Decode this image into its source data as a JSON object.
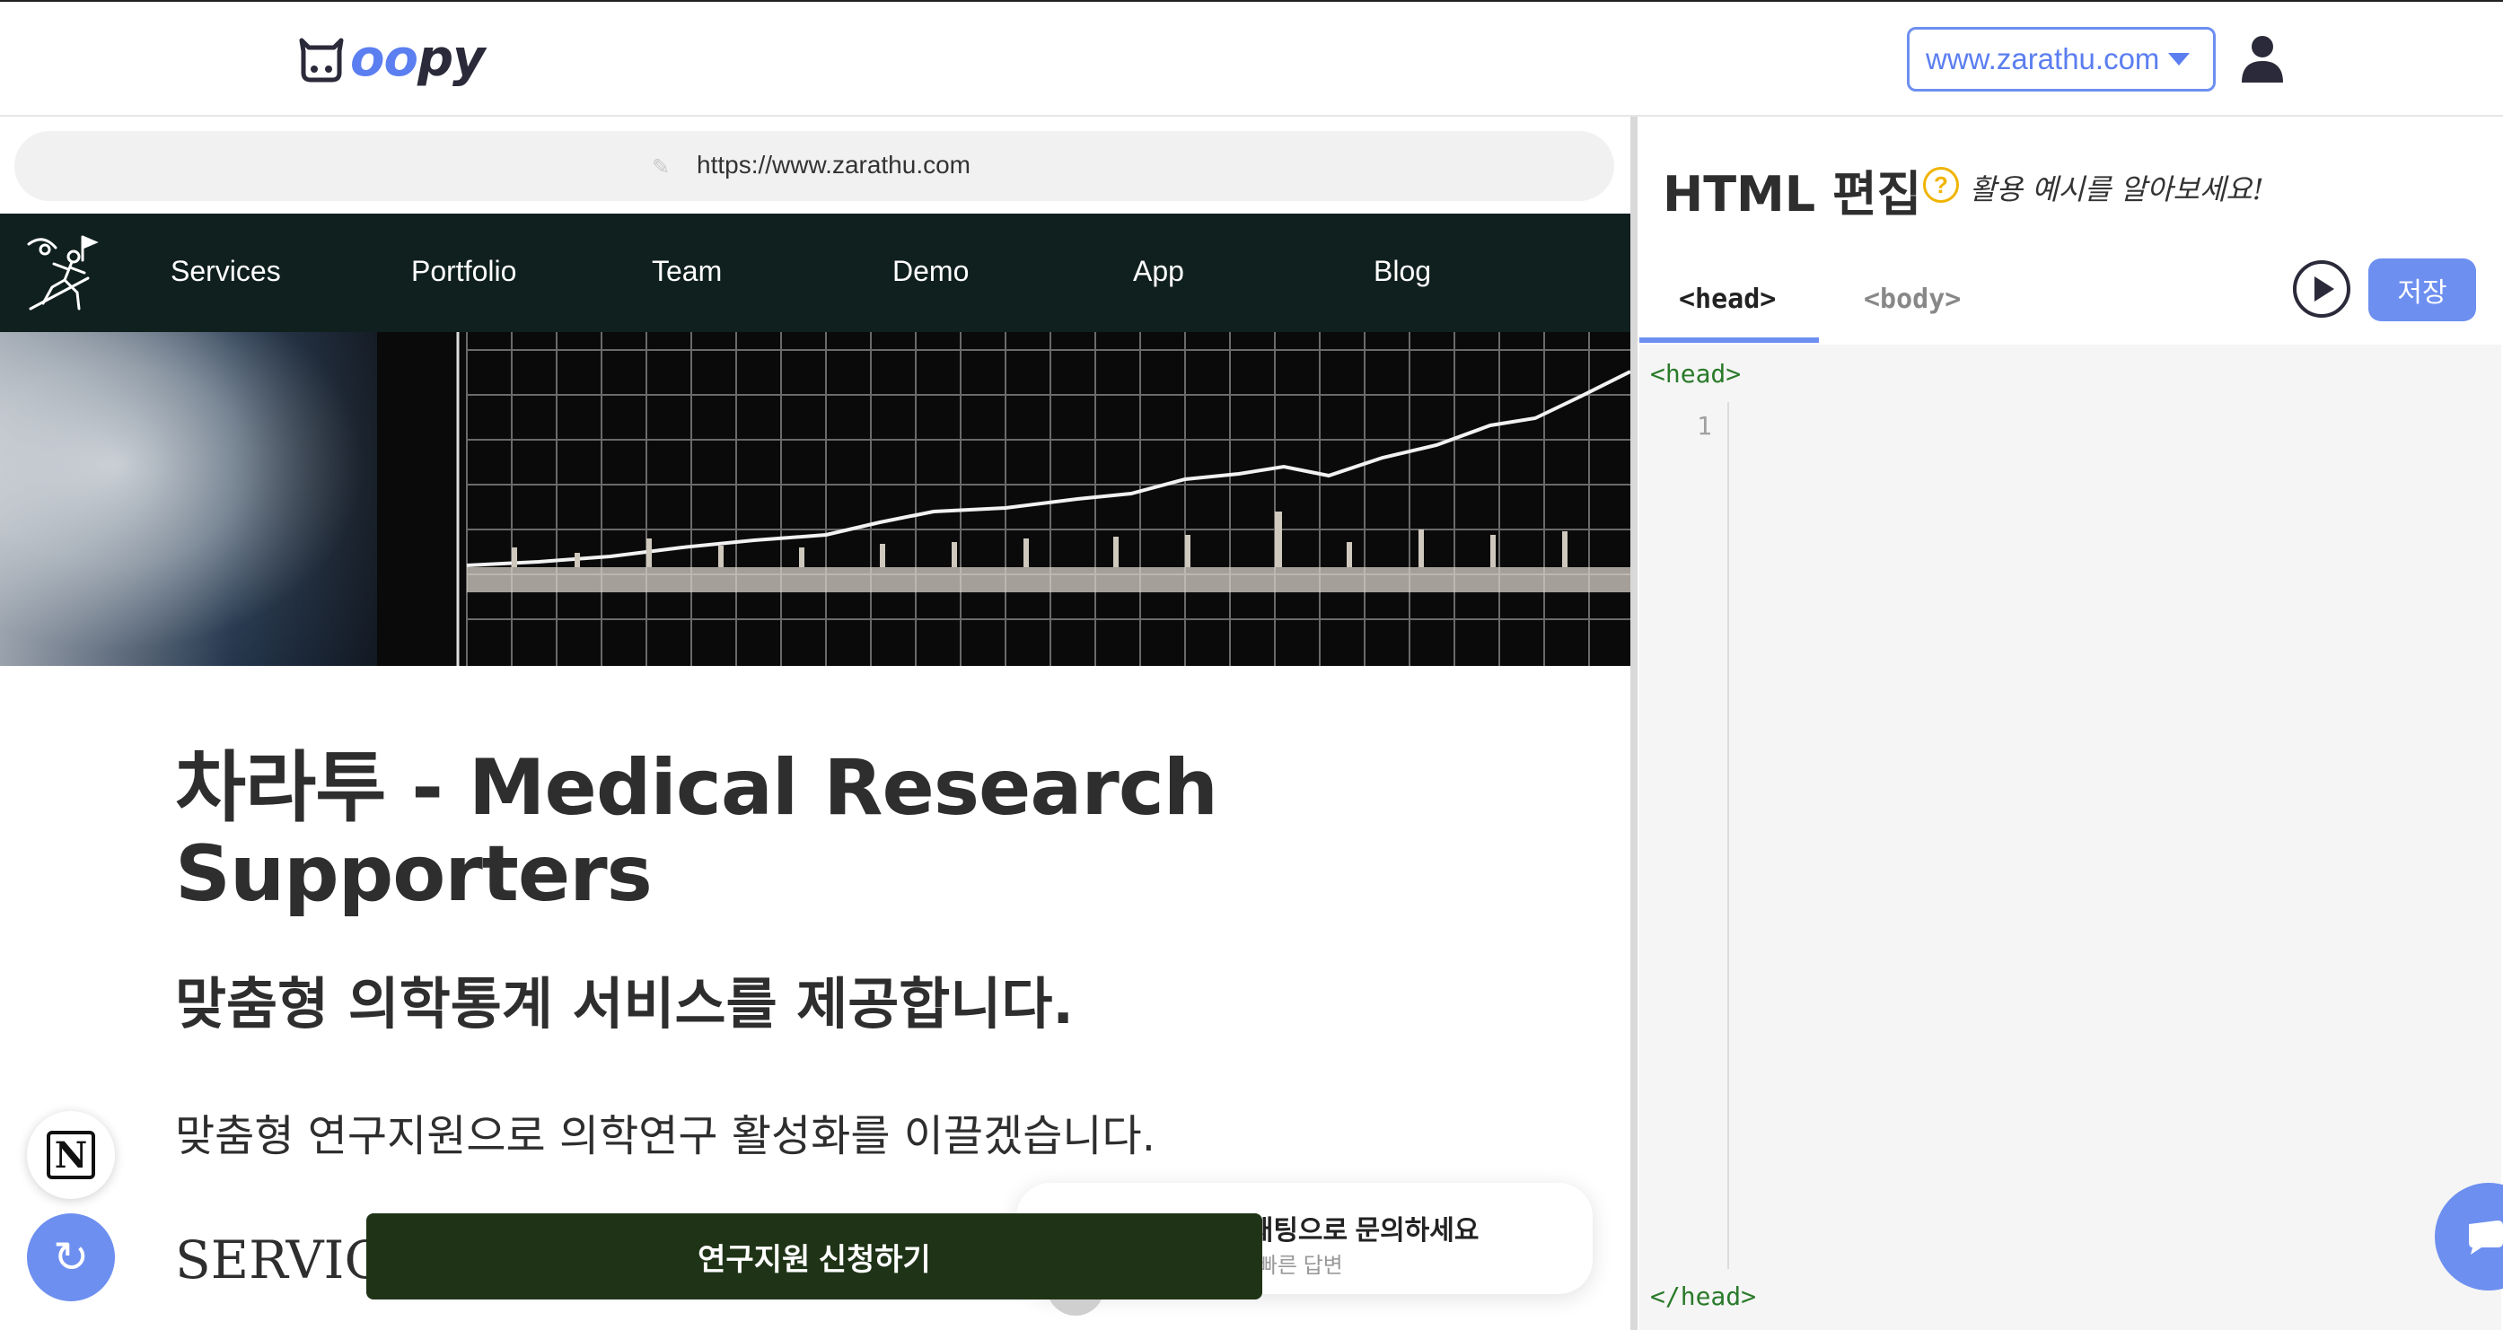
{
  "app": {
    "logo_text_blue": "oo",
    "logo_text_dark": "py",
    "domain": "www.zarathu.com"
  },
  "preview": {
    "url": "https://www.zarathu.com",
    "nav": [
      "Services",
      "Portfolio",
      "Team",
      "Demo",
      "App",
      "Blog"
    ],
    "heading": "차라투 - Medical Research Supporters",
    "subheading": "맞춤형 의학통계 서비스를 제공합니다.",
    "tagline": "맞춤형 연구지원으로 의학연구 활성화를 이끌겠습니다.",
    "section_title": "SERVICES",
    "chat_card_title": "궁금하면 채팅으로 문의하세요",
    "chat_card_sub": "내 빠른 답변",
    "apply_button": "연구지원 신청하기"
  },
  "editor": {
    "title": "HTML 편집",
    "help_text": "활용 예시를 알아보세요!",
    "tabs": [
      "<head>",
      "<body>"
    ],
    "active_tab": "<head>",
    "save_label": "저장",
    "code_open": "<head>",
    "code_close": "</head>",
    "line_number": "1"
  },
  "colors": {
    "accent": "#6d8ff0",
    "nav_bg": "#10201e",
    "apply_bg": "#1f3417",
    "help": "#f0b400"
  }
}
